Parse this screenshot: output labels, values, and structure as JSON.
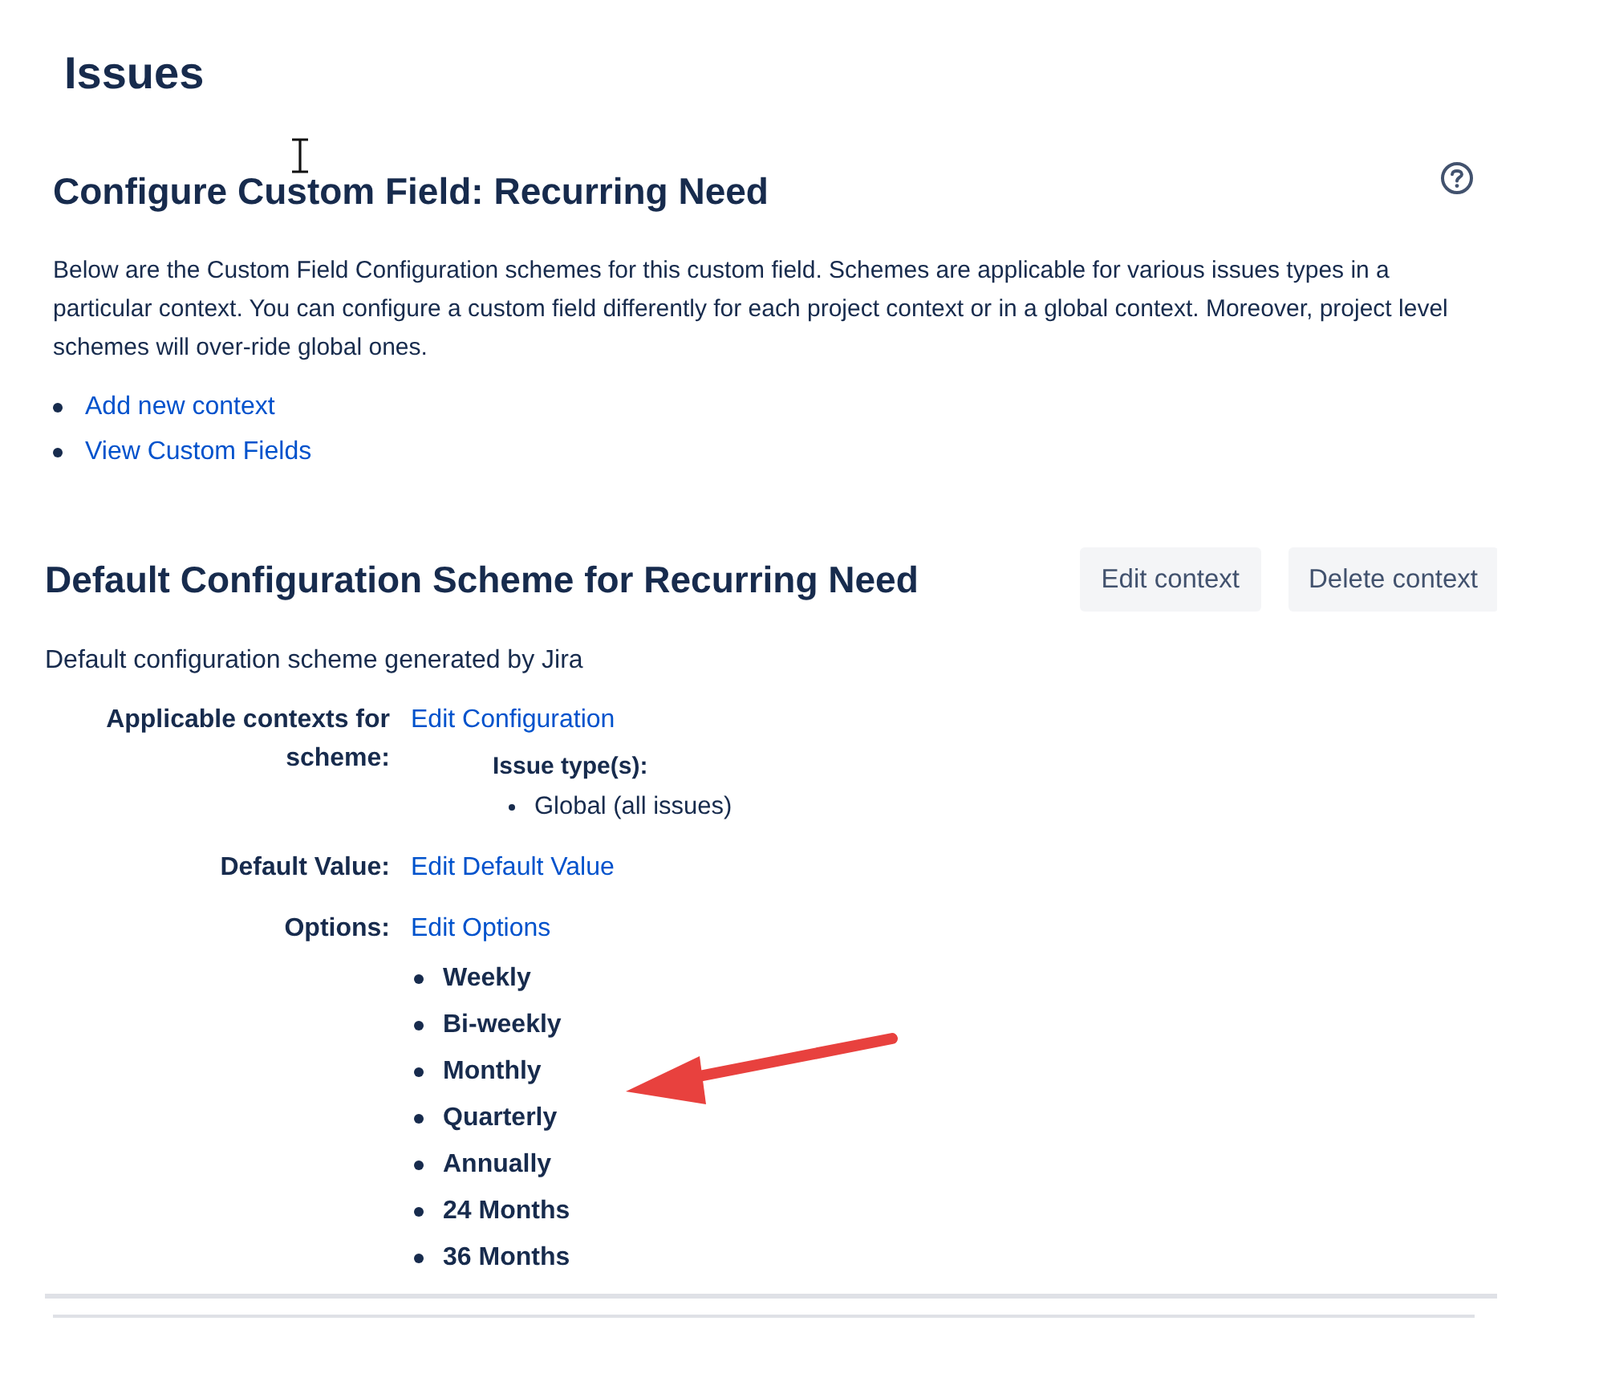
{
  "page_title": "Issues",
  "section": {
    "title": "Configure Custom Field: Recurring Need",
    "description": "Below are the Custom Field Configuration schemes for this custom field. Schemes are applicable for various issues types in a particular context. You can configure a custom field differently for each project context or in a global context. Moreover, project level schemes will over-ride global ones.",
    "links": [
      "Add new context",
      "View Custom Fields"
    ]
  },
  "scheme": {
    "title": "Default Configuration Scheme for Recurring Need",
    "buttons": [
      "Edit context",
      "Delete context"
    ],
    "description": "Default configuration scheme generated by Jira",
    "rows": [
      {
        "kind": "contexts",
        "label": "Applicable contexts for scheme:",
        "link": "Edit Configuration",
        "sub_heading": "Issue type(s):",
        "items": [
          "Global (all issues)"
        ]
      },
      {
        "kind": "link",
        "label": "Default Value:",
        "link": "Edit Default Value"
      },
      {
        "kind": "options",
        "label": "Options:",
        "link": "Edit Options",
        "items": [
          "Weekly",
          "Bi-weekly",
          "Monthly",
          "Quarterly",
          "Annually",
          "24 Months",
          "36 Months"
        ]
      }
    ]
  }
}
